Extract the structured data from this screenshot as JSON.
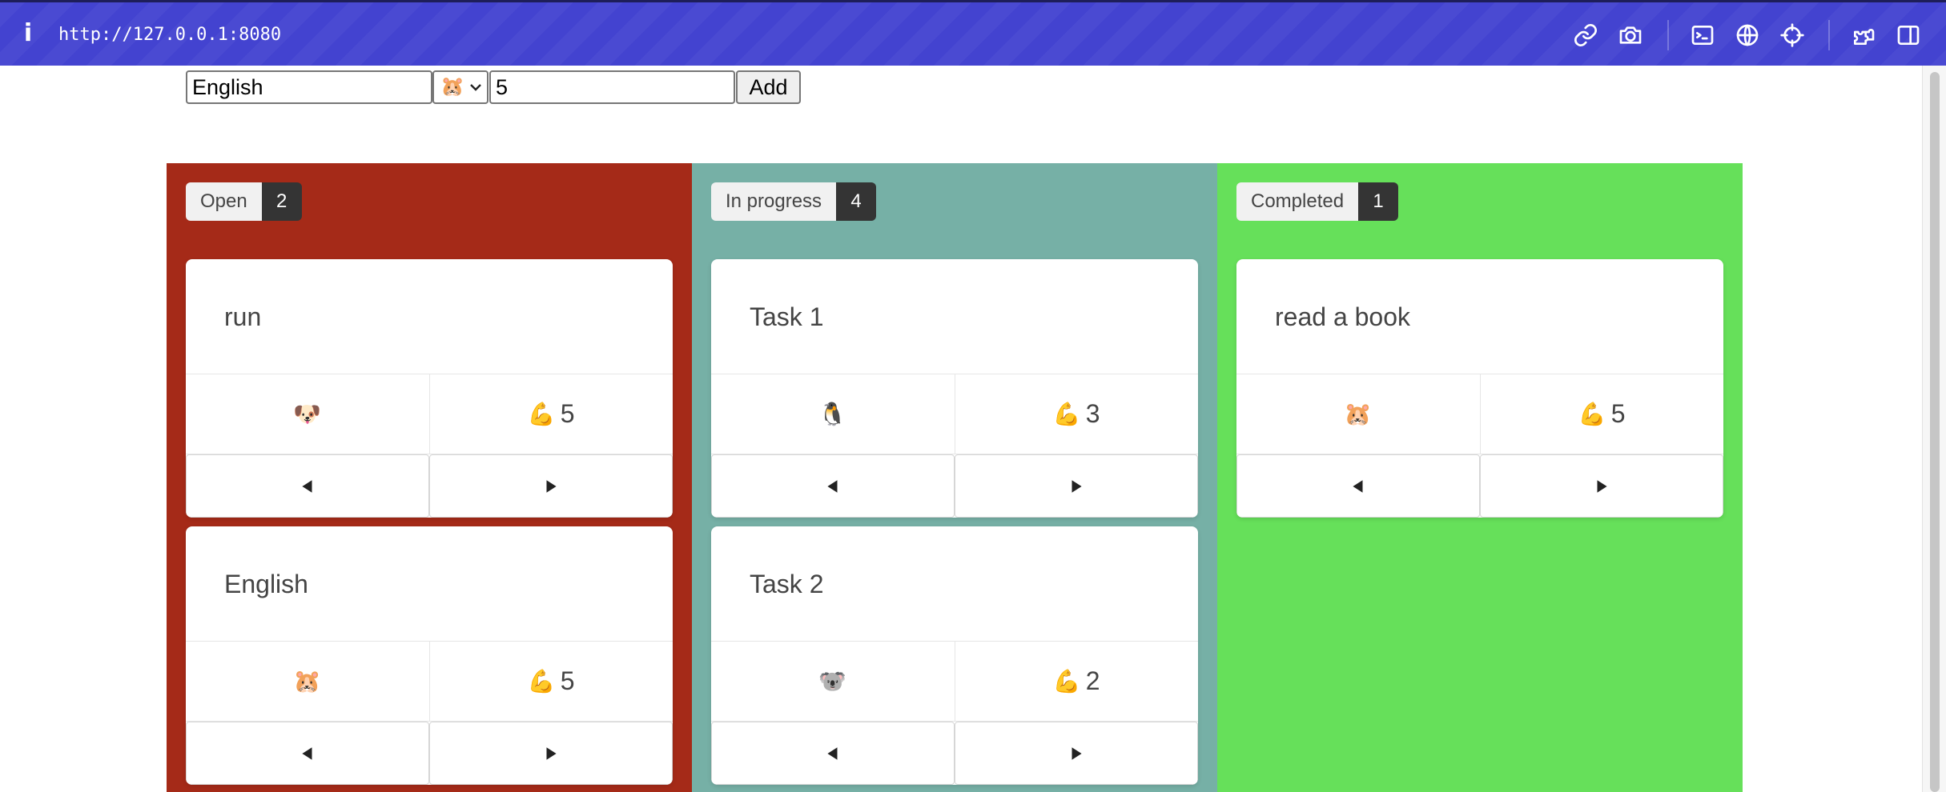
{
  "browser": {
    "info_label": "i",
    "url": "http://127.0.0.1:8080",
    "icons": [
      "link-icon",
      "camera-icon",
      "terminal-icon",
      "globe-icon",
      "crosshair-icon",
      "extensions-icon",
      "sidebar-icon"
    ]
  },
  "form": {
    "task_value": "English",
    "selected_owner": "🐹",
    "effort_value": "5",
    "add_label": "Add"
  },
  "columns": [
    {
      "title": "Open",
      "count": "2",
      "color": "#a52a18",
      "cards": [
        {
          "title": "run",
          "owner": "🐶",
          "effort_icon": "💪",
          "effort": "5"
        },
        {
          "title": "English",
          "owner": "🐹",
          "effort_icon": "💪",
          "effort": "5"
        }
      ]
    },
    {
      "title": "In progress",
      "count": "4",
      "color": "#76b0a6",
      "cards": [
        {
          "title": "Task 1",
          "owner": "🐧",
          "effort_icon": "💪",
          "effort": "3"
        },
        {
          "title": "Task 2",
          "owner": "🐨",
          "effort_icon": "💪",
          "effort": "2"
        }
      ]
    },
    {
      "title": "Completed",
      "count": "1",
      "color": "#66e05a",
      "cards": [
        {
          "title": "read a book",
          "owner": "🐹",
          "effort_icon": "💪",
          "effort": "5"
        }
      ]
    }
  ]
}
